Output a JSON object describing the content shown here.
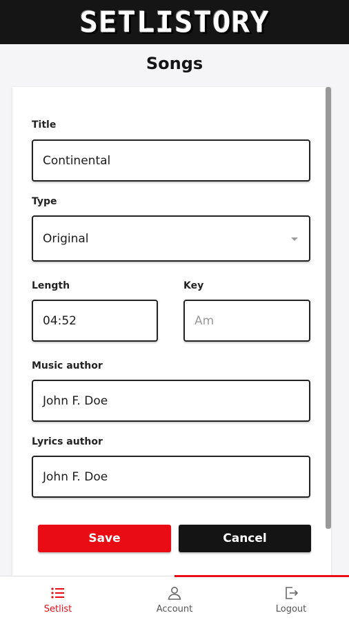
{
  "app": {
    "logo_text": "SETLISTORY"
  },
  "page": {
    "title": "Songs"
  },
  "form": {
    "title_label": "Title",
    "title_value": "Continental",
    "type_label": "Type",
    "type_value": "Original",
    "length_label": "Length",
    "length_value": "04:52",
    "key_label": "Key",
    "key_placeholder": "Am",
    "music_author_label": "Music author",
    "music_author_value": "John F. Doe",
    "lyrics_author_label": "Lyrics author",
    "lyrics_author_value": "John F. Doe"
  },
  "buttons": {
    "save_label": "Save",
    "cancel_label": "Cancel"
  },
  "bottom_nav": {
    "items": [
      {
        "label": "Setlist",
        "icon": "list-icon",
        "active": true
      },
      {
        "label": "Account",
        "icon": "user-icon",
        "active": false
      },
      {
        "label": "Logout",
        "icon": "logout-icon",
        "active": false
      }
    ]
  },
  "colors": {
    "accent": "#e90c14",
    "dark": "#141414"
  }
}
